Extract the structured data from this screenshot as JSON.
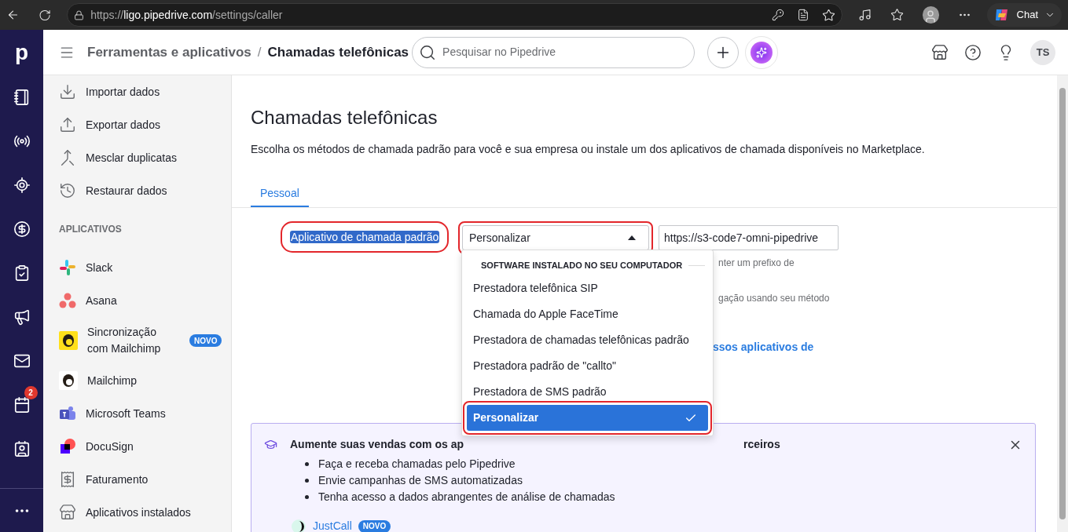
{
  "browser": {
    "url_scheme": "https://",
    "url_host": "ligo.pipedrive.com",
    "url_path": "/settings/caller",
    "chat": "Chat"
  },
  "rail": {
    "logo": "p",
    "calendar_badge": "2"
  },
  "header": {
    "breadcrumb_parent": "Ferramentas e aplicativos",
    "breadcrumb_separator": "/",
    "breadcrumb_current": "Chamadas telefônicas",
    "search_placeholder": "Pesquisar no Pipedrive",
    "avatar": "TS"
  },
  "sidebar": {
    "items": [
      {
        "label": "Importar dados"
      },
      {
        "label": "Exportar dados"
      },
      {
        "label": "Mesclar duplicatas"
      },
      {
        "label": "Restaurar dados"
      }
    ],
    "section": "APLICATIVOS",
    "apps": [
      {
        "label": "Slack",
        "kind": "slack"
      },
      {
        "label": "Asana",
        "kind": "asana"
      },
      {
        "label": "Sincronização com Mailchimp",
        "kind": "mailchimp-yellow",
        "badge": "NOVO"
      },
      {
        "label": "Mailchimp",
        "kind": "mailchimp"
      },
      {
        "label": "Microsoft Teams",
        "kind": "teams"
      },
      {
        "label": "DocuSign",
        "kind": "docusign"
      },
      {
        "label": "Faturamento",
        "kind": "receipt"
      },
      {
        "label": "Aplicativos instalados",
        "kind": "store"
      }
    ]
  },
  "page": {
    "title": "Chamadas telefônicas",
    "description": "Escolha os métodos de chamada padrão para você e sua empresa ou instale um dos aplicativos de chamada disponíveis no Marketplace.",
    "tabs": [
      {
        "label": "Pessoal",
        "selected": true
      }
    ],
    "field_label": {
      "text": "Aplicativo de chamada padrão",
      "highlighted": true,
      "annotated": true
    },
    "select": {
      "value": "Personalizar",
      "expanded": true,
      "annotated": true
    },
    "url_input": {
      "value": "https://s3-code7-omni-pipedrive"
    },
    "hint_1": "nter um prefixo de",
    "hint_2": "gação usando seu método",
    "link": "ssos aplicativos de",
    "dropdown": {
      "group": "SOFTWARE INSTALADO NO SEU COMPUTADOR",
      "options": [
        {
          "label": "Prestadora telefônica SIP",
          "selected": false,
          "annotated": false
        },
        {
          "label": "Chamada do Apple FaceTime",
          "selected": false,
          "annotated": false
        },
        {
          "label": "Prestadora de chamadas telefônicas padrão",
          "selected": false,
          "annotated": false
        },
        {
          "label": "Prestadora padrão de \"callto\"",
          "selected": false,
          "annotated": false
        },
        {
          "label": "Prestadora de SMS padrão",
          "selected": false,
          "annotated": false
        },
        {
          "label": "Personalizar",
          "selected": true,
          "annotated": true
        }
      ]
    },
    "banner": {
      "title_start": "Aumente suas vendas com os ap",
      "title_end": "rceiros",
      "bullets": [
        "Faça e receba chamadas pelo Pipedrive",
        "Envie campanhas de SMS automatizadas",
        "Tenha acesso a dados abrangentes de análise de chamadas"
      ],
      "app": {
        "name": "JustCall",
        "badge": "NOVO"
      }
    }
  }
}
